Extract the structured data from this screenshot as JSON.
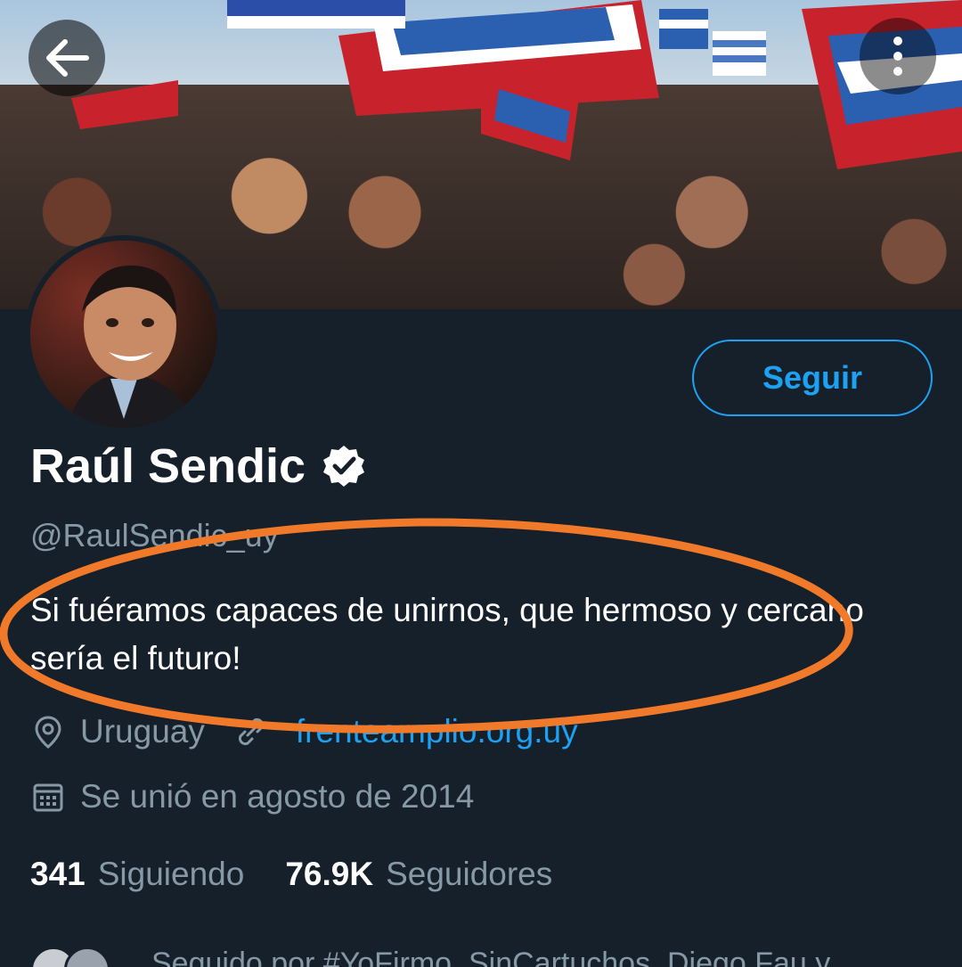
{
  "header": {
    "back_icon": "arrow-left-icon",
    "menu_icon": "more-vertical-icon"
  },
  "profile": {
    "name": "Raúl Sendic",
    "verified_icon": "verified-badge-icon",
    "handle": "@RaulSendic_uy",
    "bio": "Si fuéramos capaces de unirnos, que hermoso y cercano sería el futuro!",
    "location": "Uruguay",
    "location_icon": "location-pin-icon",
    "website": "frenteamplio.org.uy",
    "website_icon": "link-icon",
    "joined": "Se unió en agosto de 2014",
    "joined_icon": "calendar-icon"
  },
  "follow_button": {
    "label": "Seguir"
  },
  "stats": {
    "following_count": "341",
    "following_label": "Siguiendo",
    "followers_count": "76.9K",
    "followers_label": "Seguidores"
  },
  "followed_by": {
    "text": "Seguido por #YoFirmo_SinCartuchos, Diego Fau y"
  },
  "colors": {
    "background": "#15202b",
    "accent": "#1da1f2",
    "muted_text": "#8899a6",
    "annotation_oval": "#f07a2a"
  }
}
